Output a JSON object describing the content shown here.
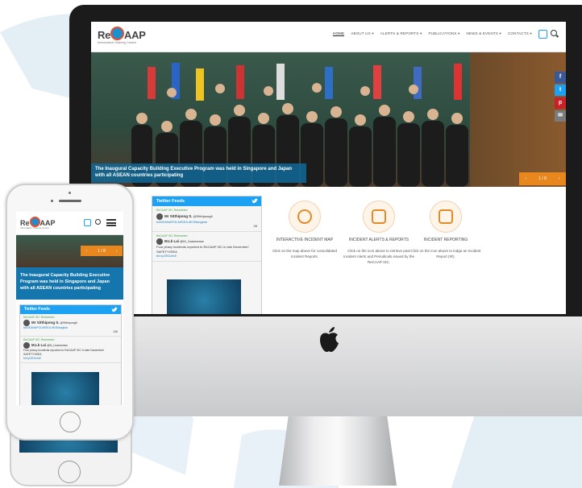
{
  "desktop": {
    "logo": {
      "text_re": "Re",
      "text_aap": "AAP",
      "tagline": "Information Sharing Centre"
    },
    "nav": [
      "HOME",
      "ABOUT US ▾",
      "ALERTS & REPORTS ▾",
      "PUBLICATIONS ▾",
      "NEWS & EVENTS ▾",
      "CONTACTS ▾"
    ],
    "hero_caption": "The Inaugural Capacity Building Executive Program was held in Singapore and Japan with all ASEAN countries participating",
    "pager": {
      "prev": "‹",
      "label": "1 / 8",
      "next": "›"
    },
    "social": [
      {
        "icon": "facebook-icon",
        "glyph": "f",
        "color": "#3b5998"
      },
      {
        "icon": "twitter-icon",
        "glyph": "t",
        "color": "#1da1f2"
      },
      {
        "icon": "pinterest-icon",
        "glyph": "p",
        "color": "#cb2027"
      },
      {
        "icon": "email-icon",
        "glyph": "✉",
        "color": "#7b7b7b"
      }
    ],
    "twitter_card": {
      "title": "Twitter Feeds",
      "tweets": [
        {
          "retweet": "ReCAAP ISC Retweeted",
          "name": "Mr Sitthipong S.",
          "handle": "@Sitthipong6",
          "text": "#ASEANAPOLMISEA #EXBangkok",
          "meta": "26"
        },
        {
          "retweet": "ReCAAP ISC Retweeted",
          "name": "M.Lk Lai",
          "handle": "@M_Lkaseansw",
          "text": "Four piracy incidents reported to ReCAAP ISC in late December! SAFETY4SEA",
          "link": "bit.ly/2EDzfoE"
        }
      ]
    },
    "features": [
      {
        "icon": "map-icon",
        "title": "INTERACTIVE INCIDENT MAP",
        "desc": "Click on the map above for consolidated Incident Reports."
      },
      {
        "icon": "alerts-reports-icon",
        "title": "INCIDENT ALERTS & REPORTS",
        "desc": "Click on the icon above to retrieve past Incident Alerts and Periodicals issued by the ReCAAP ISC."
      },
      {
        "icon": "incident-reporting-icon",
        "title": "INCIDENT REPORTING",
        "desc": "Click on the icon above to lodge an Incident Report (IR)."
      }
    ]
  },
  "mobile": {
    "logo": {
      "text_re": "Re",
      "text_aap": "AAP",
      "tagline": "Information Sharing Centre"
    },
    "pager": {
      "prev": "‹",
      "label": "1 / 8",
      "next": "›"
    },
    "hero_caption": "The Inaugural Capacity Building Executive Program was held in Singapore and Japan with all ASEAN countries participating",
    "twitter_card": {
      "title": "Twitter Feeds",
      "tweets": [
        {
          "retweet": "ReCAAP ISC Retweeted",
          "name": "Mr Sitthipong S.",
          "handle": "@Sitthipong6",
          "text": "#ASEANAPOLMISEA #EXBangkok",
          "meta": "126"
        },
        {
          "retweet": "ReCAAP ISC Retweeted",
          "name": "M.Lk Lai",
          "handle": "@M_Lkaseansw",
          "text": "Four piracy incidents reported to ReCAAP ISC in late December! SAFETY4SEA",
          "link": "bit.ly/2EDzfoE"
        }
      ]
    }
  }
}
